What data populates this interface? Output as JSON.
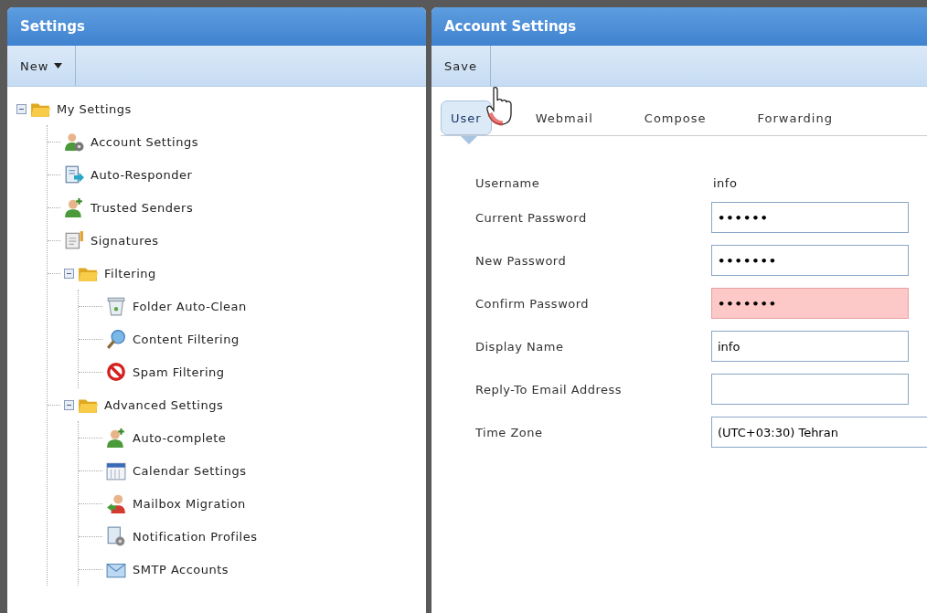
{
  "settings_panel": {
    "title": "Settings",
    "toolbar": [
      {
        "label": "New",
        "kind": "dropdown"
      }
    ],
    "tree": [
      {
        "label": "My Settings",
        "expanded": true,
        "selected": false,
        "children": [
          {
            "label": "Account Settings",
            "selected": false
          },
          {
            "label": "Auto-Responder",
            "selected": false
          },
          {
            "label": "Trusted Senders",
            "selected": false
          },
          {
            "label": "Signatures",
            "selected": false
          },
          {
            "label": "Filtering",
            "expanded": true,
            "selected": false,
            "children": [
              {
                "label": "Folder Auto-Clean",
                "selected": false
              },
              {
                "label": "Content Filtering",
                "selected": false
              },
              {
                "label": "Spam Filtering",
                "selected": false
              }
            ]
          },
          {
            "label": "Advanced Settings",
            "expanded": true,
            "selected": false,
            "children": [
              {
                "label": "Auto-complete",
                "selected": false
              },
              {
                "label": "Calendar Settings",
                "selected": false
              },
              {
                "label": "Mailbox Migration",
                "selected": false
              },
              {
                "label": "Notification Profiles",
                "selected": false
              },
              {
                "label": "SMTP Accounts",
                "selected": false
              }
            ]
          }
        ]
      }
    ]
  },
  "account_panel": {
    "title": "Account Settings",
    "toolbar": [
      {
        "label": "Save",
        "kind": "button"
      }
    ],
    "tabs": [
      {
        "label": "User",
        "selected": true
      },
      {
        "label": "Webmail",
        "selected": false
      },
      {
        "label": "Compose",
        "selected": false
      },
      {
        "label": "Forwarding",
        "selected": false
      }
    ],
    "fields": [
      {
        "label": "Username",
        "kind": "static",
        "value": "info"
      },
      {
        "label": "Current Password",
        "kind": "password",
        "value": "••••••",
        "invalid": false
      },
      {
        "label": "New Password",
        "kind": "password",
        "value": "•••••••",
        "invalid": false
      },
      {
        "label": "Confirm Password",
        "kind": "password",
        "value": "•••••••",
        "invalid": true
      },
      {
        "label": "Display Name",
        "kind": "text",
        "value": "info",
        "invalid": false
      },
      {
        "label": "Reply-To Email Address",
        "kind": "text",
        "invalid": false
      },
      {
        "label": "Time Zone",
        "kind": "select",
        "value": "(UTC+03:30) Tehran",
        "invalid": false
      }
    ]
  }
}
